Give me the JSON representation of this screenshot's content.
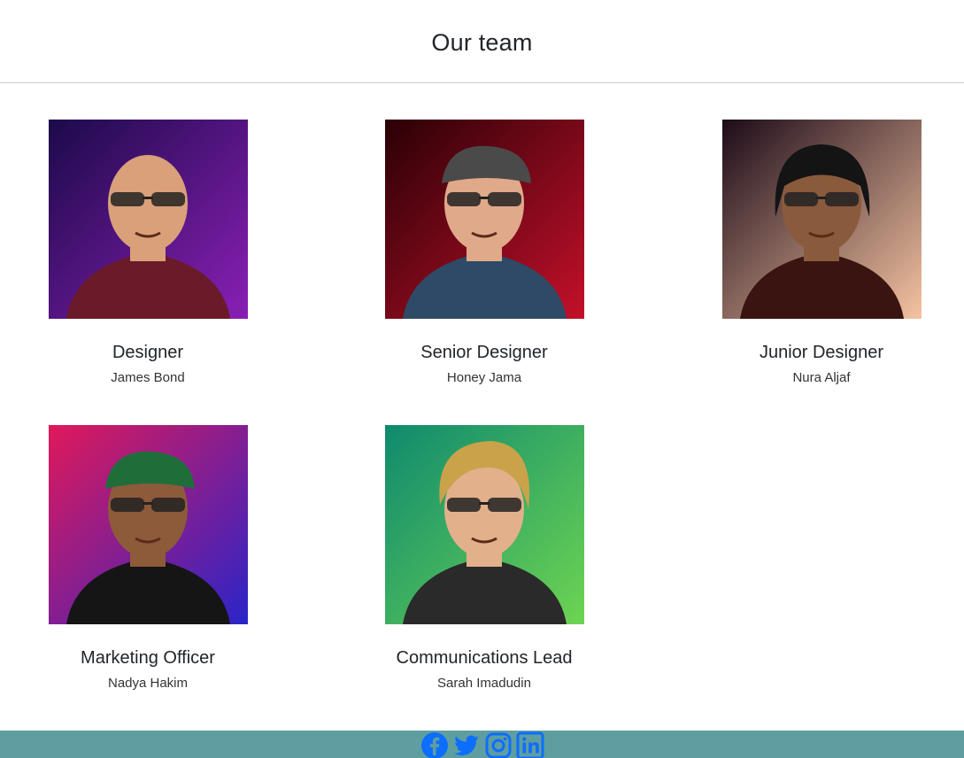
{
  "header": {
    "title": "Our team"
  },
  "members": [
    {
      "role": "Designer",
      "name": "James Bond",
      "bg1": "#1c0a4a",
      "bg2": "#8a1fb5",
      "skin": "#d9a07a",
      "shirt": "#6b1a2a",
      "accent": "#1e88e5"
    },
    {
      "role": "Senior Designer",
      "name": "Honey Jama",
      "bg1": "#2a0006",
      "bg2": "#c4102a",
      "skin": "#e0a98a",
      "shirt": "#2e4a66",
      "accent": "#4a4a4a"
    },
    {
      "role": "Junior Designer",
      "name": "Nura Aljaf",
      "bg1": "#1c0b18",
      "bg2": "#f5c3a2",
      "skin": "#8a5a3c",
      "shirt": "#3a1410",
      "accent": "#1a1a1a"
    },
    {
      "role": "Marketing Officer",
      "name": "Nadya Hakim",
      "bg1": "#e0195a",
      "bg2": "#2a24c8",
      "skin": "#8d5a3a",
      "shirt": "#151515",
      "accent": "#1f6e3a"
    },
    {
      "role": "Communications Lead",
      "name": "Sarah Imadudin",
      "bg1": "#0e8a6e",
      "bg2": "#6ed452",
      "skin": "#e2b08a",
      "shirt": "#2a2a2a",
      "accent": "#c9a24a"
    }
  ],
  "footer": {
    "color": "#5f9ea0",
    "icon_color": "#0d6efd",
    "icons": [
      "facebook-icon",
      "twitter-icon",
      "instagram-icon",
      "linkedin-icon"
    ]
  }
}
